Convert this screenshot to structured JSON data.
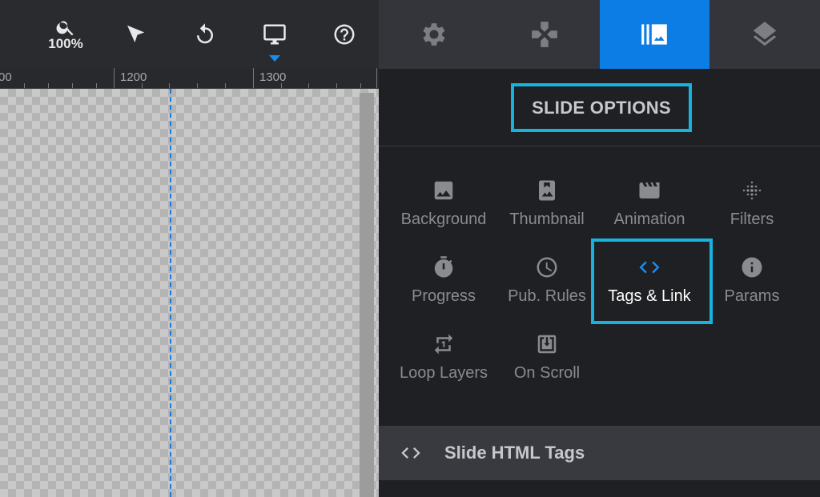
{
  "toolbar": {
    "zoom_label": "100%",
    "tools": [
      "zoom-icon",
      "select-arrow-icon",
      "undo-icon",
      "desktop-monitor-icon",
      "help-icon"
    ],
    "active_tool": "desktop-monitor-icon"
  },
  "ruler": {
    "labels": [
      "00",
      "1200",
      "1300"
    ]
  },
  "panel_tabs": {
    "tabs": [
      "gear-icon",
      "navigation-icon",
      "slide-image-icon",
      "layers-icon"
    ],
    "active_tab": "slide-image-icon"
  },
  "panel": {
    "title": "SLIDE OPTIONS",
    "options": [
      {
        "label": "Background",
        "icon": "image-icon"
      },
      {
        "label": "Thumbnail",
        "icon": "thumbnail-icon"
      },
      {
        "label": "Animation",
        "icon": "clapper-icon"
      },
      {
        "label": "Filters",
        "icon": "filters-dots-icon"
      },
      {
        "label": "Progress",
        "icon": "stopwatch-icon"
      },
      {
        "label": "Pub. Rules",
        "icon": "clock-icon"
      },
      {
        "label": "Tags & Link",
        "icon": "code-brackets-icon"
      },
      {
        "label": "Params",
        "icon": "info-icon"
      },
      {
        "label": "Loop Layers",
        "icon": "repeat-one-icon"
      },
      {
        "label": "On Scroll",
        "icon": "scroll-download-icon"
      }
    ],
    "selected_option": "Tags & Link",
    "section_title": "Slide HTML Tags"
  },
  "colors": {
    "accent_blue": "#0d7de6",
    "highlight_cyan": "#17b2dd",
    "panel_bg": "#1f2023"
  }
}
